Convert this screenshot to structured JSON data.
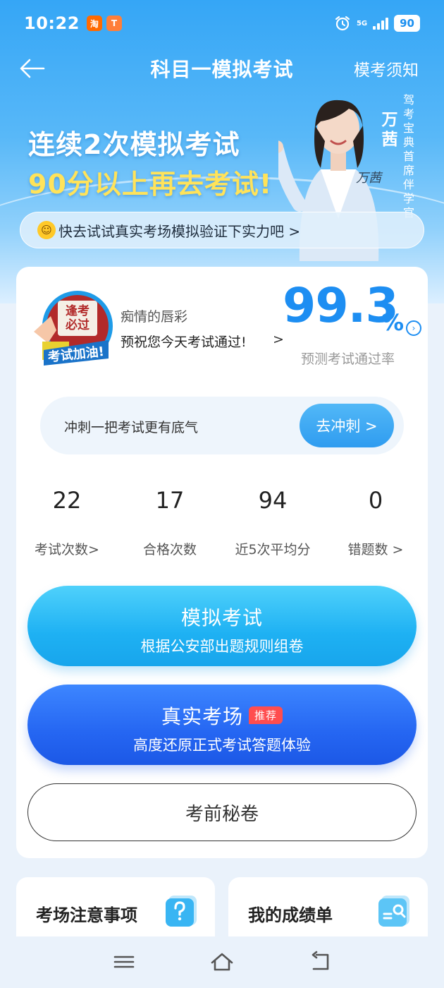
{
  "status_bar": {
    "time": "10:22",
    "app_badges": [
      {
        "icon": "taobao-icon",
        "glyph": "淘",
        "color": "#ff6a00"
      },
      {
        "icon": "shop-icon",
        "glyph": "T",
        "color": "#ff7f3a"
      }
    ],
    "network": "5G",
    "battery": "90"
  },
  "header": {
    "title": "科目一模拟考试",
    "notice_link": "模考须知"
  },
  "banner": {
    "line1": "连续2次模拟考试",
    "line2": "90分以上再去考试!",
    "person_name": "万茜",
    "person_role": "驾考宝典首席伴学官",
    "promo_text": "快去试试真实考场模拟验证下实力吧 >"
  },
  "profile": {
    "mascot_text_top": "逢考必过",
    "mascot_text_bottom": "考试加油!",
    "user_name": "痴情的唇彩",
    "wish": "预祝您今天考试通过!",
    "pass_rate": "99.3",
    "pass_rate_unit": "%",
    "pass_rate_label": "预测考试通过率"
  },
  "sprint": {
    "text": "冲刺一把考试更有底气",
    "button": "去冲刺 >"
  },
  "stats": [
    {
      "value": "22",
      "label": "考试次数>"
    },
    {
      "value": "17",
      "label": "合格次数"
    },
    {
      "value": "94",
      "label": "近5次平均分"
    },
    {
      "value": "0",
      "label": "错题数 >"
    }
  ],
  "actions": {
    "mock_title": "模拟考试",
    "mock_sub": "根据公安部出题规则组卷",
    "real_title": "真实考场",
    "real_badge": "推荐",
    "real_sub": "高度还原正式考试答题体验",
    "secret": "考前秘卷"
  },
  "tiles": [
    {
      "label": "考场注意事项",
      "icon": "question-icon"
    },
    {
      "label": "我的成绩单",
      "icon": "report-icon"
    }
  ],
  "colors": {
    "brand_blue": "#1d8ef2",
    "mock_button": "#1eb1f3",
    "real_button": "#2566f2",
    "highlight_yellow": "#ffe35a",
    "badge_red": "#ff4d4f"
  }
}
